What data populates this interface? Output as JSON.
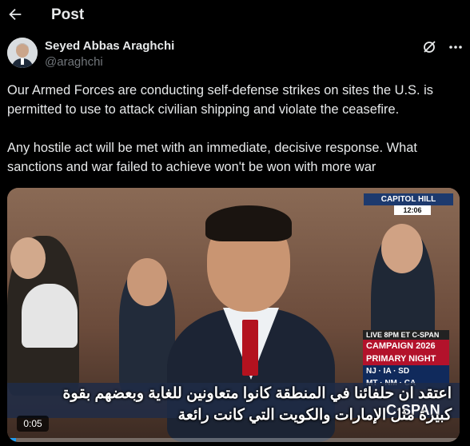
{
  "header": {
    "back_icon": "arrow-left-icon",
    "title": "Post"
  },
  "author": {
    "name": "Seyed Abbas Araghchi",
    "handle": "@araghchi"
  },
  "actions": {
    "grok_icon": "grok-icon",
    "more_icon": "more-icon"
  },
  "post": {
    "text": "Our Armed Forces are conducting self-defense strikes on sites the U.S. is permitted to use to attack civilian shipping and violate the ceasefire.\n\nAny hostile act will be met with an immediate, decisive response. What sanctions and war failed to achieve won't be won with more war"
  },
  "video": {
    "network_badge": "CAPITOL HILL",
    "clock": "12:06",
    "live_label": "LIVE 8PM ET C-SPAN",
    "campaign_label": "CAMPAIGN 2026",
    "campaign_sub": "PRIMARY NIGHT",
    "states_1": "NJ · IA · SD",
    "states_2": "MT · NM · CA",
    "channel_logo": "C·SPAN",
    "subtitles": "اعتقد ان حلفائنا في المنطقة كانوا متعاونين للغاية وبعضهم بقوة\nكبيرة مثل الإمارات والكويت التي كانت رائعة",
    "elapsed": "0:05",
    "progress_fraction": 0.02
  },
  "colors": {
    "accent": "#1d9bf0",
    "muted": "#71767b",
    "text": "#e7e9ea"
  }
}
